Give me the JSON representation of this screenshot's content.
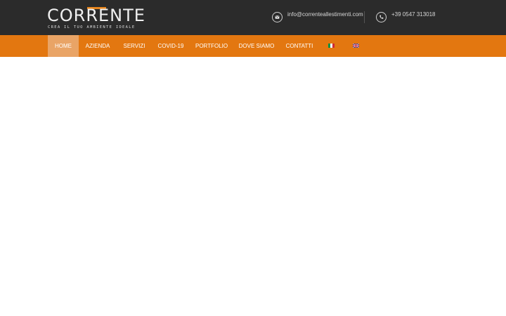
{
  "brand": {
    "name": "CORRENTE",
    "tagline": "CREA IL TUO AMBIENTE IDEALE",
    "accent_color": "#e8861e"
  },
  "contact": {
    "email": "info@correnteallestimenti.com",
    "email_icon": "envelope-icon",
    "phone": "+39 0547 313018",
    "phone_icon": "phone-icon"
  },
  "nav": {
    "items": [
      {
        "label": "HOME",
        "active": true
      },
      {
        "label": "AZIENDA",
        "active": false
      },
      {
        "label": "SERVIZI",
        "active": false
      },
      {
        "label": "COVID-19",
        "active": false
      },
      {
        "label": "PORTFOLIO",
        "active": false
      },
      {
        "label": "DOVE SIAMO",
        "active": false
      },
      {
        "label": "CONTATTI",
        "active": false
      }
    ],
    "languages": [
      "italian-flag-icon",
      "english-flag-icon"
    ],
    "background_color": "#e37710",
    "active_color": "#e9a466"
  },
  "header": {
    "background_color": "#2b2b2b"
  }
}
